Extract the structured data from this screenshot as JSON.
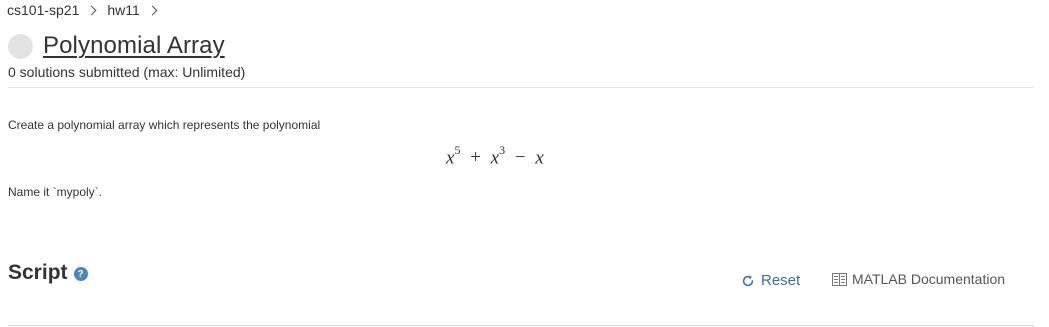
{
  "breadcrumb": {
    "items": [
      {
        "label": "cs101-sp21"
      },
      {
        "label": "hw11"
      }
    ]
  },
  "problem": {
    "title": "Polynomial Array",
    "submissions": "0 solutions submitted (max: Unlimited)",
    "description": "Create a polynomial array which represents the polynomial",
    "equation": {
      "base1": "x",
      "exp1": "5",
      "op1": "+",
      "base2": "x",
      "exp2": "3",
      "op2": "−",
      "base3": "x"
    },
    "name_instruction": "Name it `mypoly`."
  },
  "script": {
    "heading": "Script",
    "help_glyph": "?",
    "reset_label": "Reset",
    "doc_label": "MATLAB Documentation"
  },
  "icons": {
    "status": "status-circle-icon",
    "help": "help-icon",
    "reset": "refresh-icon",
    "doc": "book-icon"
  },
  "colors": {
    "accent": "#3d6ca6",
    "help_badge": "#4a86c6",
    "status_circle": "#e3e3e3"
  }
}
